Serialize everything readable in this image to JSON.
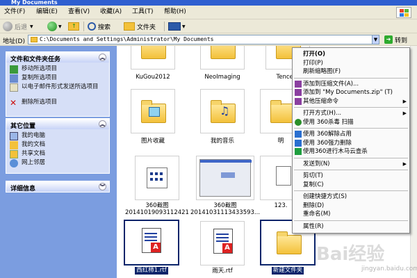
{
  "window": {
    "title": "My Documents"
  },
  "menubar": {
    "items": [
      "文件(F)",
      "编辑(E)",
      "查看(V)",
      "收藏(A)",
      "工具(T)",
      "帮助(H)"
    ]
  },
  "toolbar": {
    "back": "后退",
    "search": "搜索",
    "folders": "文件夹"
  },
  "address": {
    "label": "地址(D)",
    "path": "C:\\Documents and Settings\\Administrator\\My Documents",
    "go": "转到"
  },
  "sidebar": {
    "tasks": {
      "title": "文件和文件夹任务",
      "items": [
        "移动所选项目",
        "复制所选项目",
        "以电子邮件形式发送所选项目",
        "删除所选项目"
      ]
    },
    "places": {
      "title": "其它位置",
      "items": [
        "我的电脑",
        "我的文档",
        "共享文档",
        "网上邻居"
      ]
    },
    "details": {
      "title": "详细信息"
    }
  },
  "files": [
    {
      "name": "KuGou2012",
      "kind": "folder"
    },
    {
      "name": "NeoImaging",
      "kind": "folder"
    },
    {
      "name": "Tencent",
      "kind": "folder"
    },
    {
      "name": "图片收藏",
      "kind": "folder-pictures"
    },
    {
      "name": "我的音乐",
      "kind": "folder-music"
    },
    {
      "name": "明",
      "kind": "folder"
    },
    {
      "name": "360截图\n20141019093112421",
      "kind": "image"
    },
    {
      "name": "360截图\n20141031113433593...",
      "kind": "screenshot"
    },
    {
      "name": "123.",
      "kind": "text"
    },
    {
      "name": "西红柿1.rtf",
      "kind": "rtf",
      "selected": true
    },
    {
      "name": "雨天.rtf",
      "kind": "rtf"
    },
    {
      "name": "新建文件夹",
      "kind": "folder",
      "selected": true
    }
  ],
  "context_menu": {
    "items": [
      {
        "label": "打开(O)",
        "bold": true
      },
      {
        "label": "打印(P)"
      },
      {
        "label": "刷新缩略图(F)"
      },
      {
        "sep": true
      },
      {
        "label": "添加到压缩文件(A)...",
        "icon": "archive"
      },
      {
        "label": "添加到 \"My Documents.zip\" (T)",
        "icon": "archive"
      },
      {
        "label": "其他压缩命令",
        "icon": "archive",
        "submenu": true
      },
      {
        "sep": true
      },
      {
        "label": "打开方式(H)...",
        "submenu": true
      },
      {
        "label": "使用 360杀毒 扫描",
        "icon": "shield"
      },
      {
        "sep": true
      },
      {
        "label": "使用 360解除占用",
        "icon": "360"
      },
      {
        "label": "使用 360强力删除",
        "icon": "360"
      },
      {
        "label": "使用360进行木马云查杀",
        "icon": "360green"
      },
      {
        "sep": true
      },
      {
        "label": "发送到(N)",
        "submenu": true
      },
      {
        "sep": true
      },
      {
        "label": "剪切(T)"
      },
      {
        "label": "复制(C)"
      },
      {
        "sep": true
      },
      {
        "label": "创建快捷方式(S)"
      },
      {
        "label": "删除(D)"
      },
      {
        "label": "重命名(M)"
      },
      {
        "sep": true
      },
      {
        "label": "属性(R)"
      }
    ]
  },
  "watermark": {
    "text": "Bai经验",
    "url": "jingyan.baidu.com"
  },
  "colors": {
    "selection": "#0a246a",
    "sidebar": "#7b9de0",
    "chrome": "#ece9d8"
  }
}
